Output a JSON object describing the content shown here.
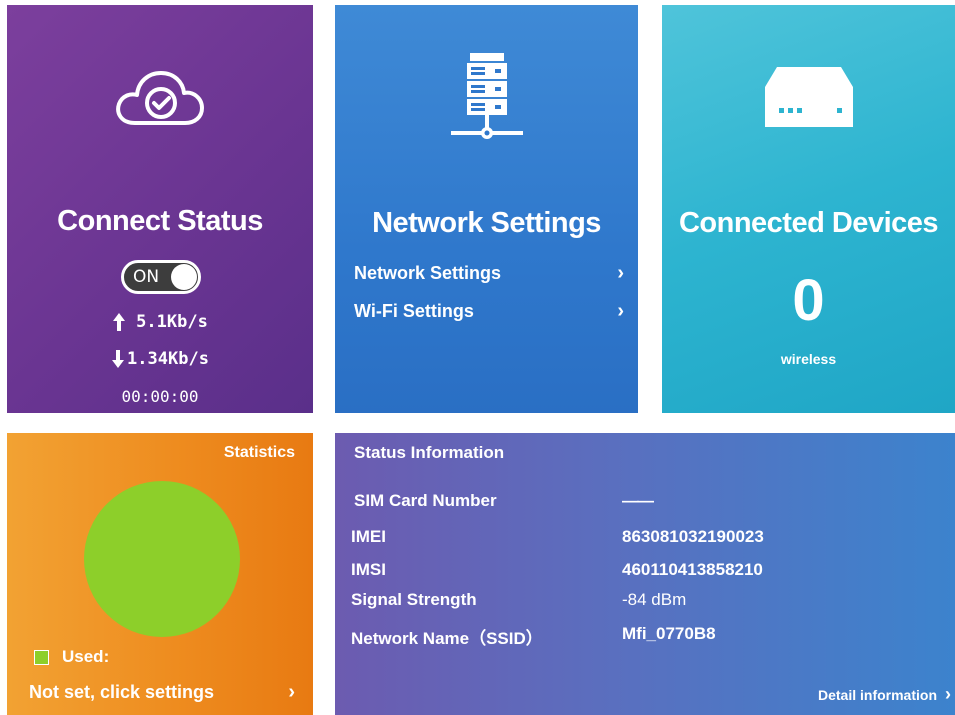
{
  "connect": {
    "title": "Connect Status",
    "toggle_label": "ON",
    "upload_rate": "5.1Kb/s",
    "download_rate": "1.34Kb/s",
    "duration": "00:00:00",
    "icon": "cloud-check-icon"
  },
  "network": {
    "title": "Network Settings",
    "icon": "server-network-icon",
    "links": [
      {
        "label": "Network Settings",
        "chevron": "›"
      },
      {
        "label": "Wi-Fi Settings",
        "chevron": "›"
      }
    ]
  },
  "devices": {
    "title": "Connected Devices",
    "icon": "router-icon",
    "count": "0",
    "type": "wireless"
  },
  "statistics": {
    "title": "Statistics",
    "used_label": "Used:",
    "settings_link": "Not set, click settings",
    "chevron": "›",
    "pie_color": "#8dcf2a",
    "swatch_color": "#8dcf2a"
  },
  "status": {
    "title": "Status Information",
    "rows": [
      {
        "label": "SIM Card Number",
        "value": "——"
      },
      {
        "label": "IMEI",
        "value": "863081032190023"
      },
      {
        "label": "IMSI",
        "value": "460110413858210"
      },
      {
        "label": "Signal Strength",
        "value": "-84 dBm"
      },
      {
        "label": "Network Name（SSID）",
        "value": "Mfi_0770B8"
      }
    ],
    "detail_link": "Detail information",
    "chevron": "›"
  },
  "colors": {
    "connect_bg": "#6a3592",
    "network_bg": "#2f78cc",
    "devices_bg": "#2db4d0",
    "stats_bg": "#ee8c1f",
    "status_bg": "#5a6fbf"
  }
}
